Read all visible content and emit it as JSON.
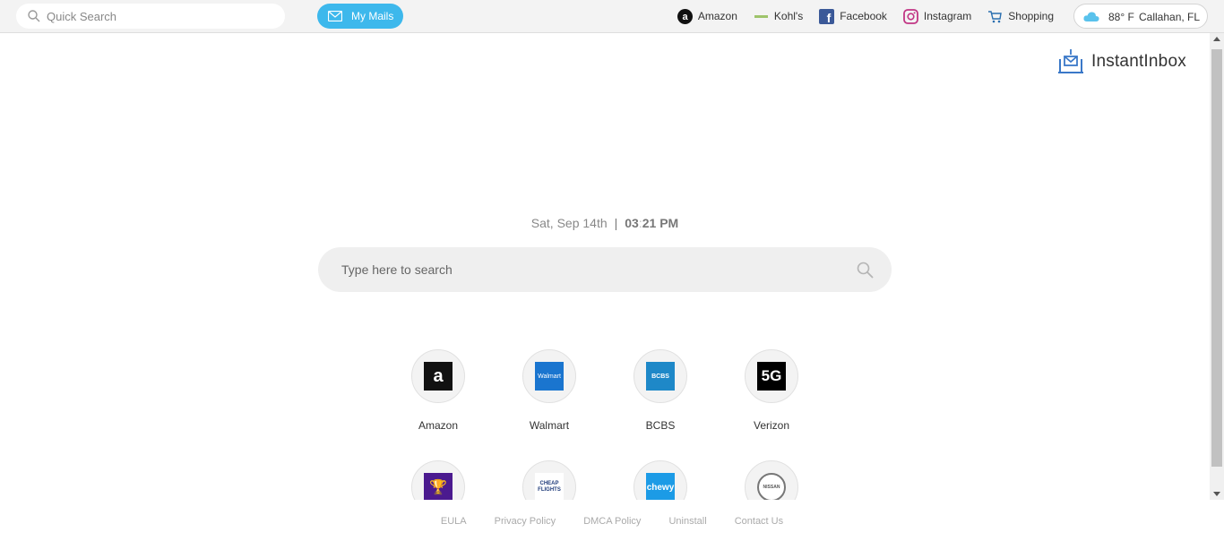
{
  "topbar": {
    "quick_search_placeholder": "Quick Search",
    "mymails_label": "My Mails",
    "links": [
      {
        "label": "Amazon",
        "icon": "amazon-icon"
      },
      {
        "label": "Kohl's",
        "icon": "kohls-icon"
      },
      {
        "label": "Facebook",
        "icon": "facebook-icon"
      },
      {
        "label": "Instagram",
        "icon": "instagram-icon"
      },
      {
        "label": "Shopping",
        "icon": "cart-icon"
      }
    ],
    "weather": {
      "temp": "88° F",
      "location": "Callahan, FL",
      "icon": "cloud-icon"
    }
  },
  "brand": {
    "name": "InstantInbox",
    "icon": "inbox-icon"
  },
  "datetime": {
    "date": "Sat, Sep 14th",
    "separator": "|",
    "hours": "03",
    "colon": ":",
    "minutes": "21",
    "ampm": "PM"
  },
  "main_search": {
    "placeholder": "Type here to search"
  },
  "tiles": [
    {
      "label": "Amazon",
      "logo_text": "a"
    },
    {
      "label": "Walmart",
      "logo_text": "Walmart"
    },
    {
      "label": "BCBS",
      "logo_text": "BCBS"
    },
    {
      "label": "Verizon",
      "logo_text": "5G"
    },
    {
      "label": "",
      "logo_text": "🏆"
    },
    {
      "label": "",
      "logo_text": "CHEAP FLIGHTS"
    },
    {
      "label": "",
      "logo_text": "chewy"
    },
    {
      "label": "",
      "logo_text": "NISSAN"
    }
  ],
  "footer": [
    "EULA",
    "Privacy Policy",
    "DMCA Policy",
    "Uninstall",
    "Contact Us"
  ],
  "colors": {
    "accent": "#3db8ec",
    "topbar_bg": "#f3f3f3",
    "search_bg": "#efefef"
  }
}
